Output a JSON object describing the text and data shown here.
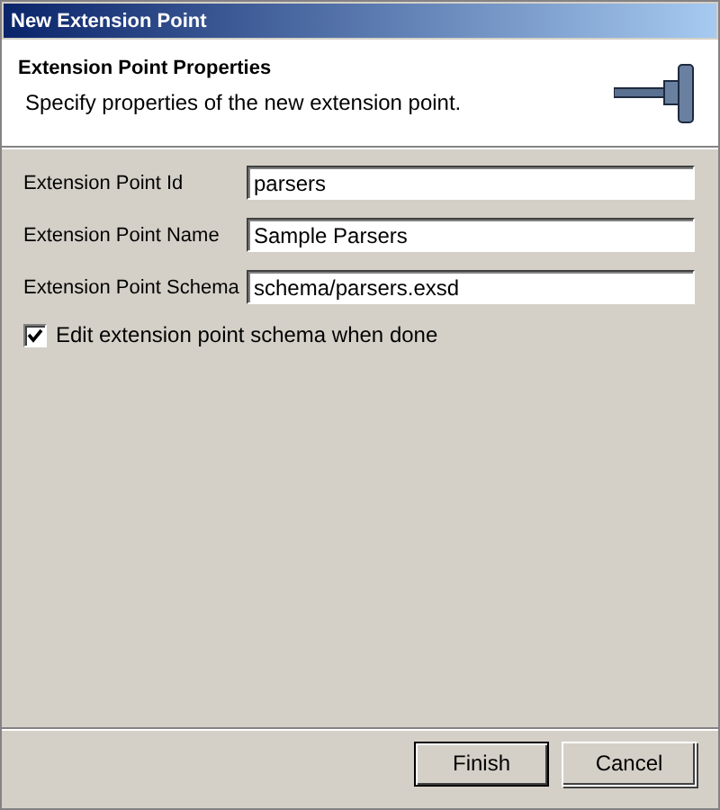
{
  "window": {
    "title": "New Extension Point"
  },
  "header": {
    "title": "Extension Point Properties",
    "description": "Specify properties of the new extension point."
  },
  "fields": [
    {
      "label": "Extension Point Id",
      "value": "parsers"
    },
    {
      "label": "Extension Point Name",
      "value": "Sample Parsers"
    },
    {
      "label": "Extension Point Schema",
      "value": "schema/parsers.exsd"
    }
  ],
  "checkbox": {
    "label": "Edit extension point schema when done",
    "checked": true
  },
  "buttons": [
    {
      "label": "Finish",
      "default": true
    },
    {
      "label": "Cancel",
      "default": false
    }
  ]
}
